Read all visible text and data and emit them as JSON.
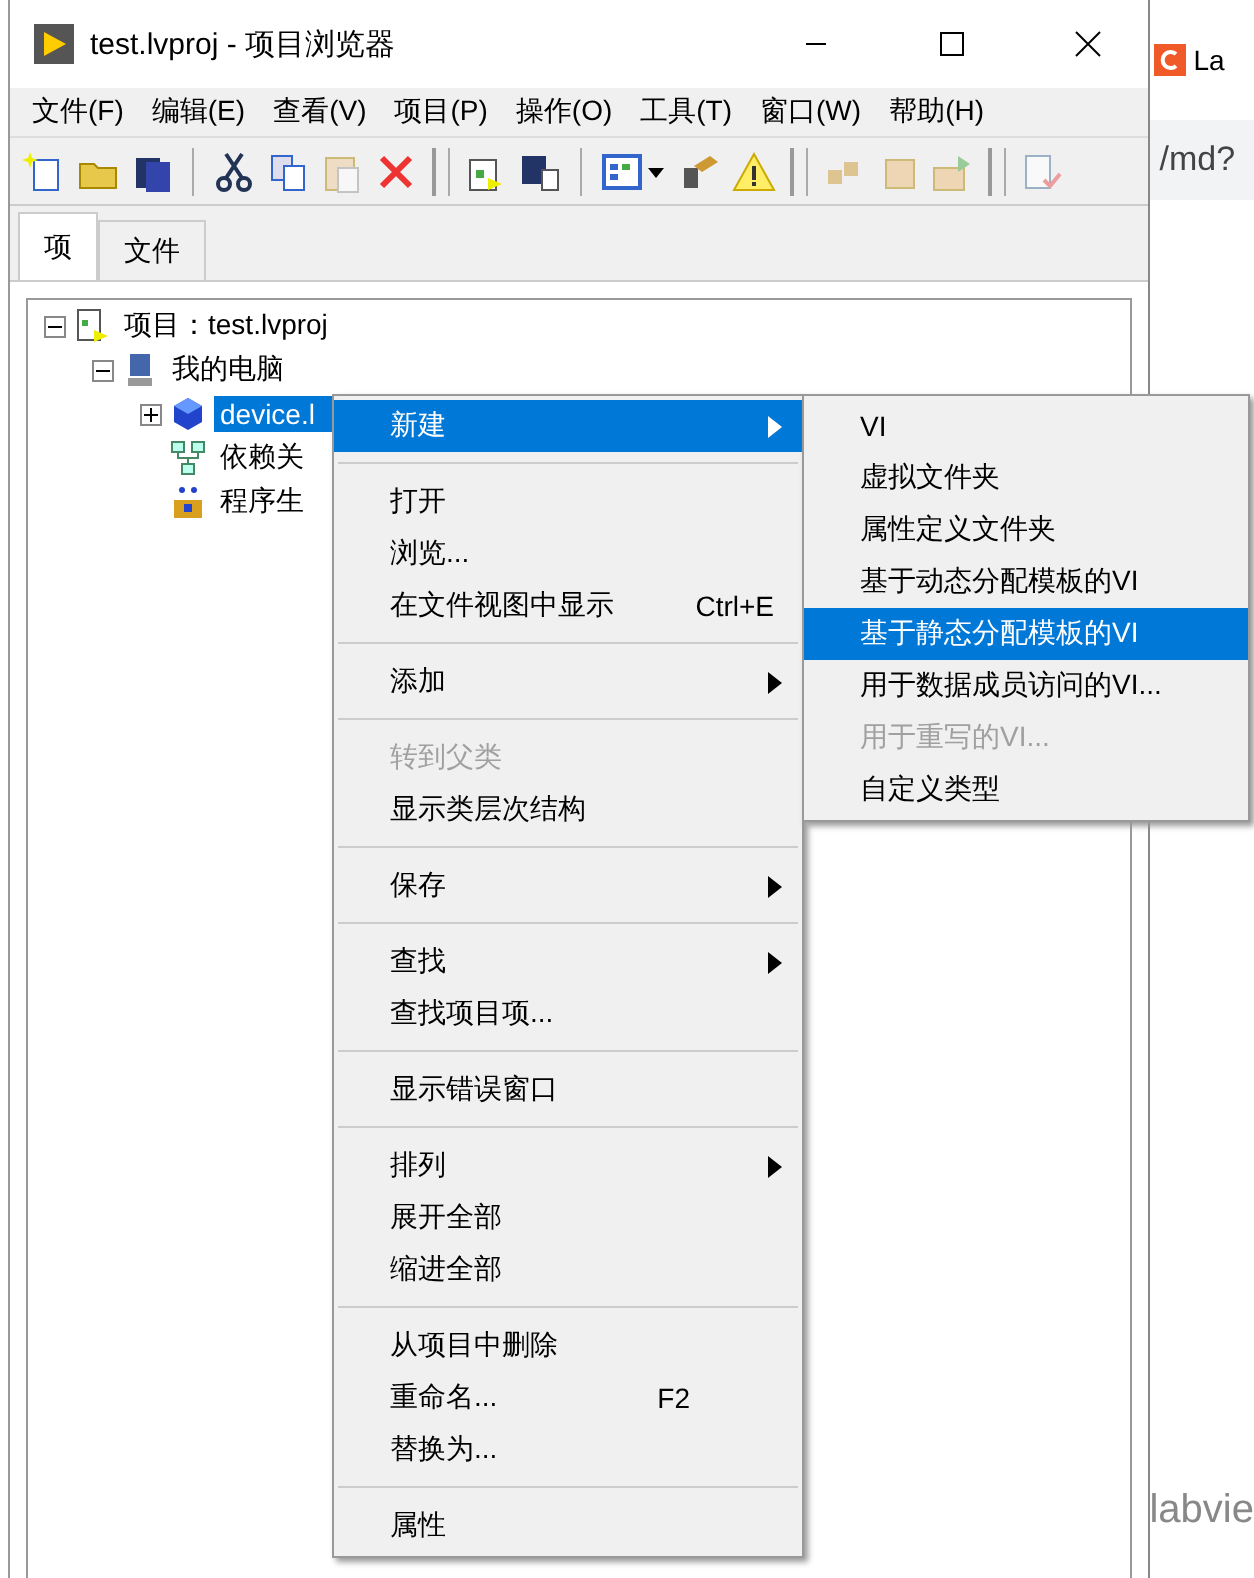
{
  "window": {
    "title": "test.lvproj - 项目浏览器"
  },
  "menu_bar": [
    "文件(F)",
    "编辑(E)",
    "查看(V)",
    "项目(P)",
    "操作(O)",
    "工具(T)",
    "窗口(W)",
    "帮助(H)"
  ],
  "toolbar": [
    {
      "kind": "new"
    },
    {
      "kind": "open"
    },
    {
      "kind": "save-all"
    },
    {
      "kind": "gap"
    },
    {
      "kind": "cut"
    },
    {
      "kind": "copy"
    },
    {
      "kind": "paste"
    },
    {
      "kind": "delete"
    },
    {
      "kind": "grip"
    },
    {
      "kind": "project"
    },
    {
      "kind": "save-project"
    },
    {
      "kind": "gap"
    },
    {
      "kind": "grid-menu"
    },
    {
      "kind": "deploy"
    },
    {
      "kind": "warning"
    },
    {
      "kind": "grip"
    },
    {
      "kind": "build"
    },
    {
      "kind": "package"
    },
    {
      "kind": "build-run"
    },
    {
      "kind": "grip"
    },
    {
      "kind": "doc"
    }
  ],
  "tabs": [
    {
      "label": "项",
      "selected": true
    },
    {
      "label": "文件",
      "selected": false
    }
  ],
  "tree": [
    {
      "label": "项目：test.lvproj",
      "kind": "project",
      "expanded": true,
      "selected": false,
      "children": [
        {
          "label": "我的电脑",
          "kind": "computer",
          "expanded": true,
          "selected": false,
          "children": [
            {
              "label": "device.l",
              "kind": "class",
              "expanded": false,
              "selected": true
            },
            {
              "label": "依赖关",
              "kind": "dependencies",
              "selected": false
            },
            {
              "label": "程序生",
              "kind": "build",
              "selected": false
            }
          ]
        }
      ]
    }
  ],
  "context_menu": [
    {
      "kind": "item",
      "label": "新建",
      "has_submenu": true,
      "disabled": false,
      "selected": true
    },
    {
      "kind": "separator"
    },
    {
      "kind": "item",
      "label": "打开",
      "has_submenu": false,
      "disabled": false,
      "selected": false
    },
    {
      "kind": "item",
      "label": "浏览...",
      "has_submenu": false,
      "disabled": false,
      "selected": false
    },
    {
      "kind": "item",
      "label": "在文件视图中显示",
      "shortcut": "Ctrl+E",
      "has_submenu": false,
      "disabled": false,
      "selected": false
    },
    {
      "kind": "separator"
    },
    {
      "kind": "item",
      "label": "添加",
      "has_submenu": true,
      "disabled": false,
      "selected": false
    },
    {
      "kind": "separator"
    },
    {
      "kind": "item",
      "label": "转到父类",
      "has_submenu": false,
      "disabled": true,
      "selected": false
    },
    {
      "kind": "item",
      "label": "显示类层次结构",
      "has_submenu": false,
      "disabled": false,
      "selected": false
    },
    {
      "kind": "separator"
    },
    {
      "kind": "item",
      "label": "保存",
      "has_submenu": true,
      "disabled": false,
      "selected": false
    },
    {
      "kind": "separator"
    },
    {
      "kind": "item",
      "label": "查找",
      "has_submenu": true,
      "disabled": false,
      "selected": false
    },
    {
      "kind": "item",
      "label": "查找项目项...",
      "has_submenu": false,
      "disabled": false,
      "selected": false
    },
    {
      "kind": "separator"
    },
    {
      "kind": "item",
      "label": "显示错误窗口",
      "has_submenu": false,
      "disabled": false,
      "selected": false
    },
    {
      "kind": "separator"
    },
    {
      "kind": "item",
      "label": "排列",
      "has_submenu": true,
      "disabled": false,
      "selected": false
    },
    {
      "kind": "item",
      "label": "展开全部",
      "has_submenu": false,
      "disabled": false,
      "selected": false
    },
    {
      "kind": "item",
      "label": "缩进全部",
      "has_submenu": false,
      "disabled": false,
      "selected": false
    },
    {
      "kind": "separator"
    },
    {
      "kind": "item",
      "label": "从项目中删除",
      "has_submenu": false,
      "disabled": false,
      "selected": false
    },
    {
      "kind": "item",
      "label": "重命名...",
      "shortcut": "F2",
      "has_submenu": false,
      "disabled": false,
      "selected": false
    },
    {
      "kind": "item",
      "label": "替换为...",
      "has_submenu": false,
      "disabled": false,
      "selected": false
    },
    {
      "kind": "separator"
    },
    {
      "kind": "item",
      "label": "属性",
      "has_submenu": false,
      "disabled": false,
      "selected": false
    }
  ],
  "submenu": [
    {
      "label": "VI",
      "disabled": false,
      "selected": false
    },
    {
      "label": "虚拟文件夹",
      "disabled": false,
      "selected": false
    },
    {
      "label": "属性定义文件夹",
      "disabled": false,
      "selected": false
    },
    {
      "label": "基于动态分配模板的VI",
      "disabled": false,
      "selected": false
    },
    {
      "label": "基于静态分配模板的VI",
      "disabled": false,
      "selected": true
    },
    {
      "label": "用于数据成员访问的VI...",
      "disabled": false,
      "selected": false
    },
    {
      "label": "用于重写的VI...",
      "disabled": true,
      "selected": false
    },
    {
      "label": "自定义类型",
      "disabled": false,
      "selected": false
    }
  ],
  "background_window": {
    "tab_title": "La",
    "address": "/md?",
    "page_text": "labvie"
  }
}
